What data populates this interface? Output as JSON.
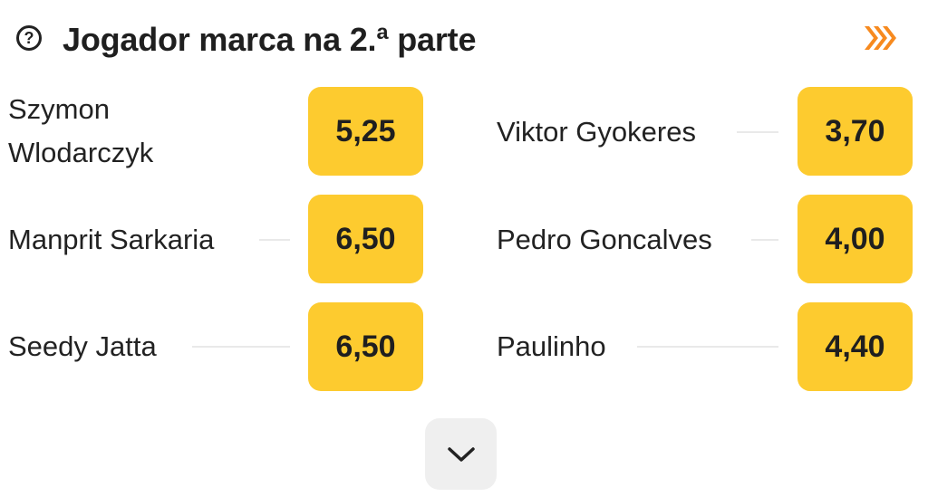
{
  "header": {
    "help_icon": "question-circle-icon",
    "title": "Jogador marca na 2.ª parte",
    "boost_icon": "boost-chevrons-icon",
    "accent": "#f78a1f"
  },
  "colors": {
    "odd_button": "#fdcb2f",
    "expand_button": "#efefef"
  },
  "markets": {
    "left": [
      {
        "name": "Szymon",
        "name2": "Wlodarczyk",
        "odd": "5,25"
      },
      {
        "name": "Manprit Sarkaria",
        "odd": "6,50"
      },
      {
        "name": "Seedy Jatta",
        "odd": "6,50"
      }
    ],
    "right": [
      {
        "name": "Viktor Gyokeres",
        "odd": "3,70"
      },
      {
        "name": "Pedro Goncalves",
        "odd": "4,00"
      },
      {
        "name": "Paulinho",
        "odd": "4,40"
      }
    ]
  },
  "expand": {
    "icon": "chevron-down-icon"
  }
}
